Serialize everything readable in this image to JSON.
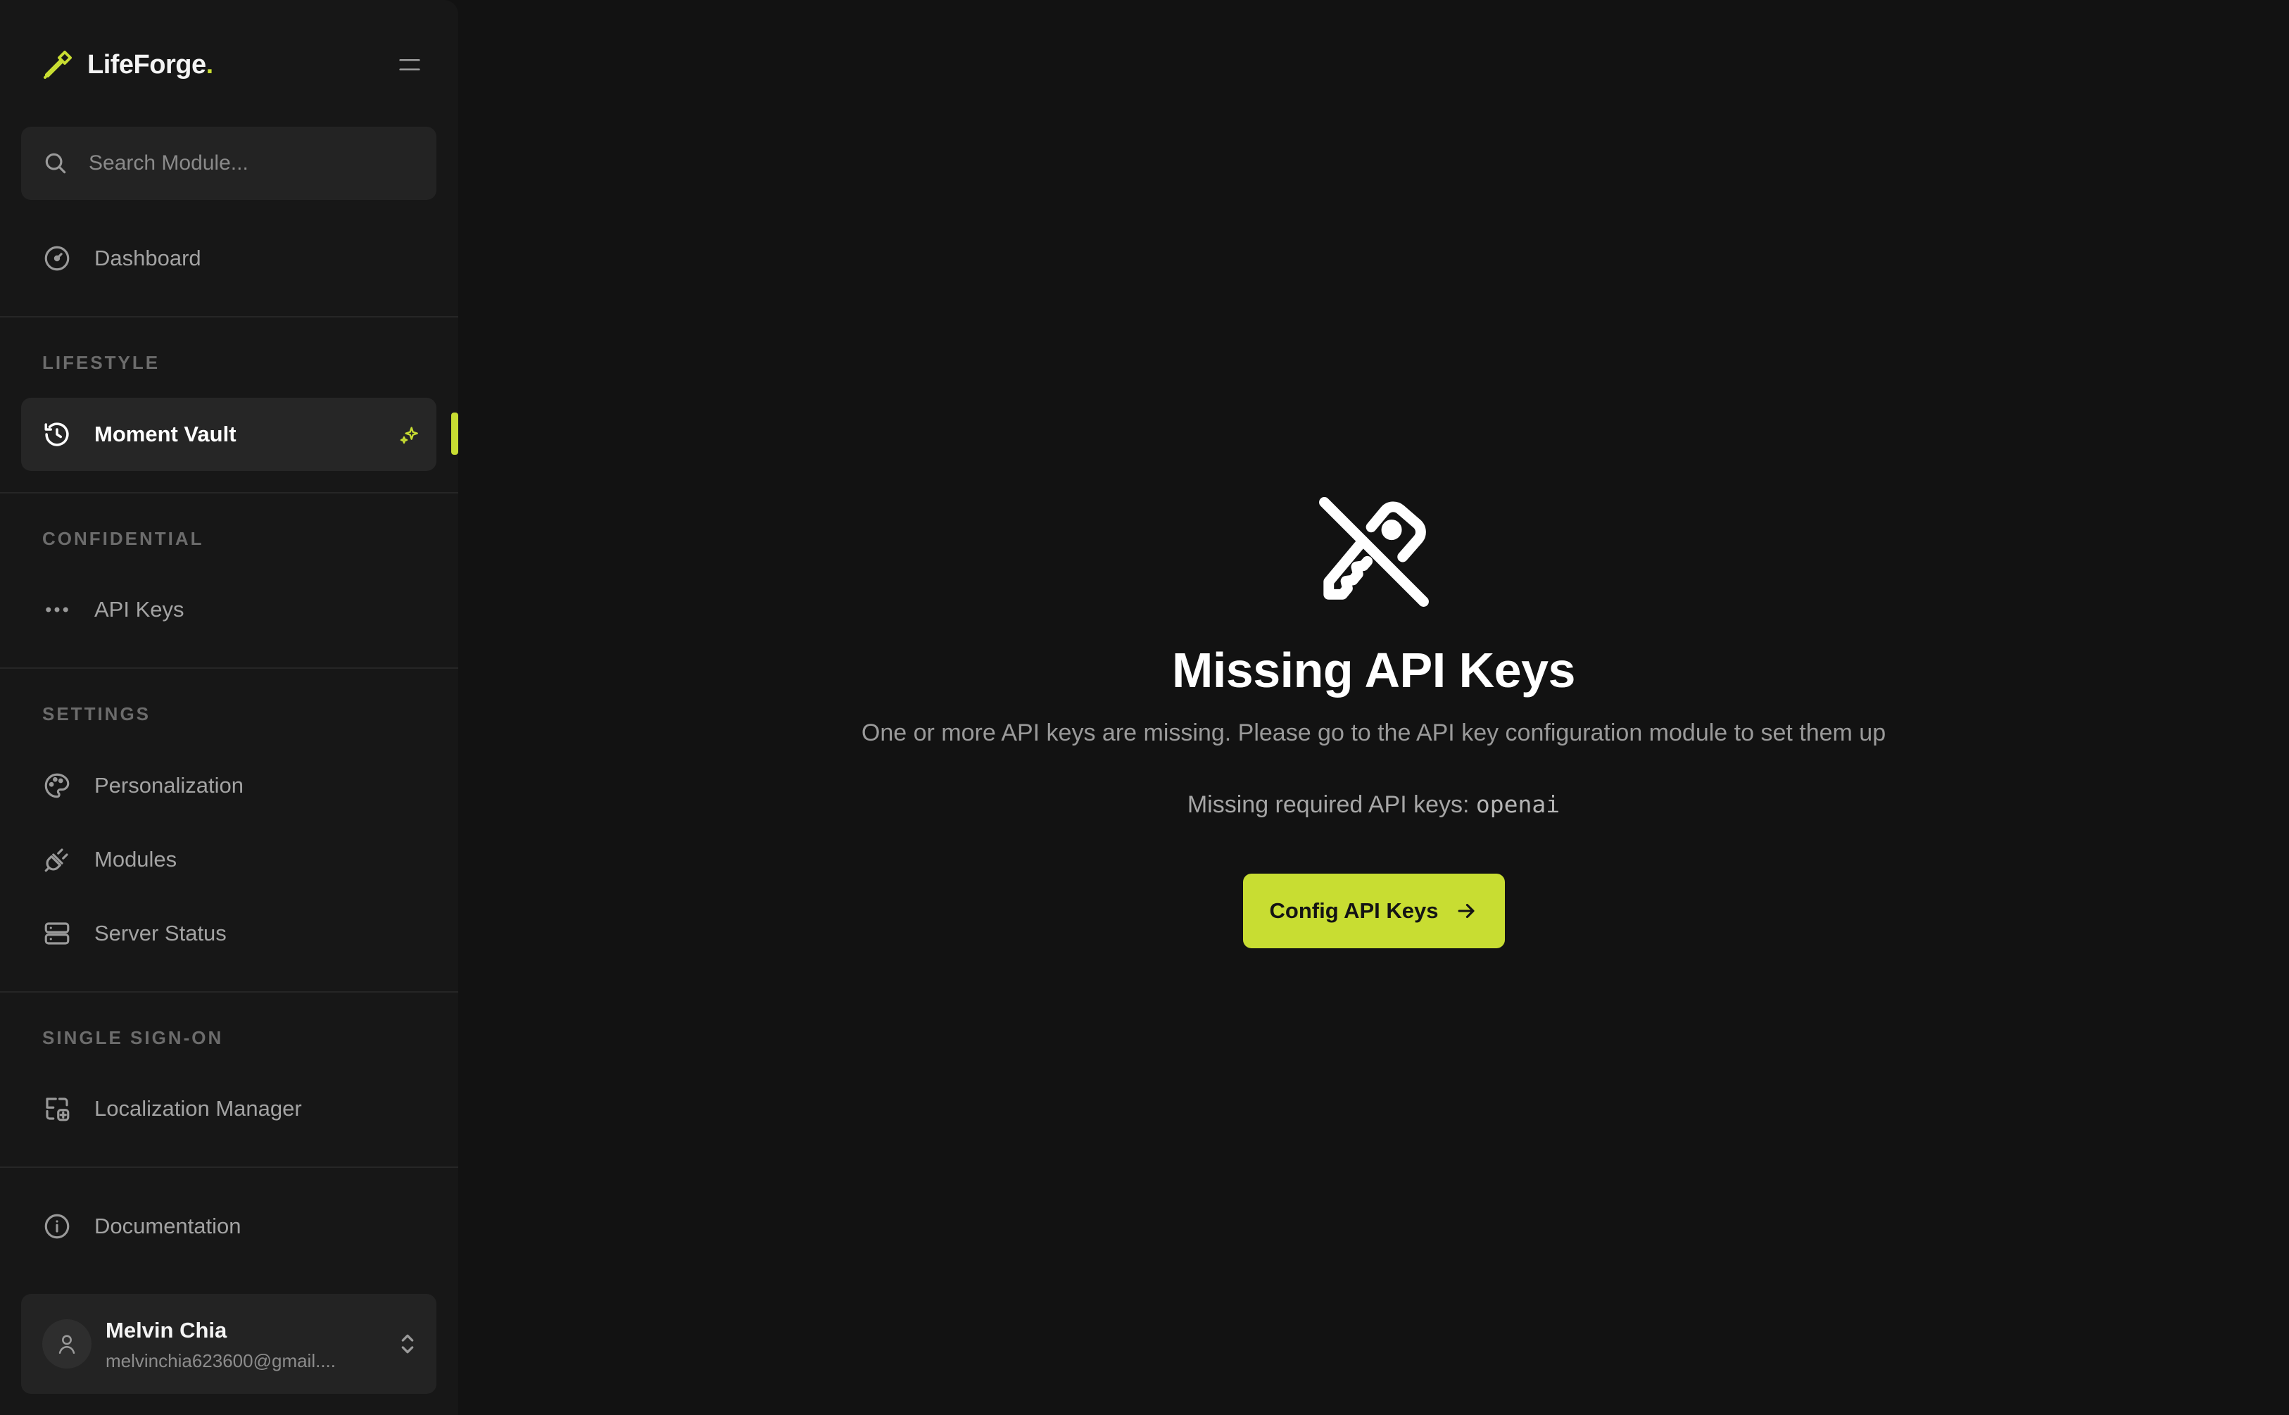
{
  "brand": {
    "name": "LifeForge",
    "dot": "."
  },
  "search": {
    "placeholder": "Search Module..."
  },
  "sidebar": {
    "dashboard": "Dashboard",
    "sections": {
      "lifestyle": "LIFESTYLE",
      "confidential": "CONFIDENTIAL",
      "settings": "SETTINGS",
      "sso": "SINGLE SIGN-ON"
    },
    "items": {
      "moment_vault": "Moment Vault",
      "api_keys": "API Keys",
      "personalization": "Personalization",
      "modules": "Modules",
      "server_status": "Server Status",
      "localization_manager": "Localization Manager",
      "documentation": "Documentation"
    },
    "active_item": "Moment Vault"
  },
  "user": {
    "name": "Melvin Chia",
    "email": "melvinchia623600@gmail...."
  },
  "main": {
    "title": "Missing API Keys",
    "description": "One or more API keys are missing. Please go to the API key configuration module to set them up",
    "missing_prefix": "Missing required API keys: ",
    "missing_keys": "openai",
    "cta_label": "Config API Keys"
  },
  "colors": {
    "accent": "#c8dd32",
    "background": "#121212",
    "sidebar": "#171717"
  },
  "icons": {
    "brand": "hammer-icon",
    "menu": "menu-icon",
    "search": "search-icon",
    "dashboard": "gauge-icon",
    "moment_vault": "history-icon",
    "api_keys": "dots-icon",
    "personalization": "palette-icon",
    "modules": "plug-icon",
    "server_status": "server-icon",
    "localization": "translate-icon",
    "documentation": "info-icon",
    "hero": "key-off-icon",
    "cta": "arrow-right-icon"
  }
}
